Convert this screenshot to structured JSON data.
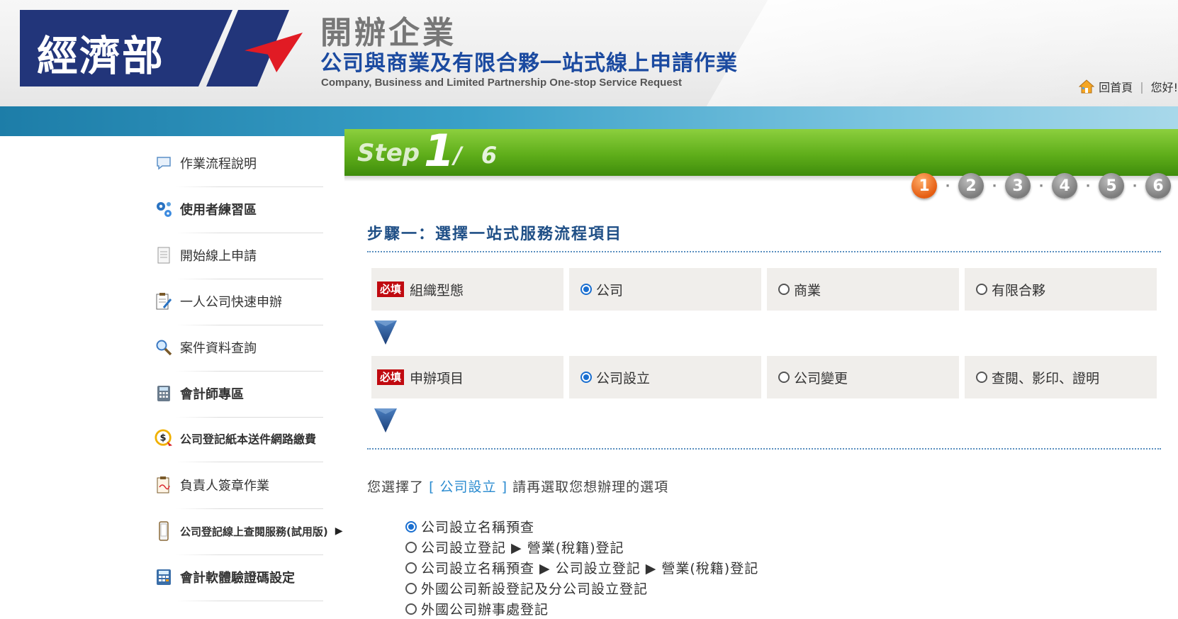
{
  "header": {
    "logo_text": "經濟部",
    "brand_title": "開辦企業",
    "brand_subtitle": "公司與商業及有限合夥一站式線上申請作業",
    "brand_english": "Company, Business and Limited Partnership One-stop Service Request",
    "home_link": "回首頁",
    "greeting": "您好!"
  },
  "sidebar": {
    "items": [
      {
        "label": "作業流程說明",
        "icon": "chat-bubble-icon"
      },
      {
        "label": "使用者練習區",
        "icon": "gears-icon"
      },
      {
        "label": "開始線上申請",
        "icon": "document-icon"
      },
      {
        "label": "一人公司快速申辦",
        "icon": "clipboard-pen-icon"
      },
      {
        "label": "案件資料查詢",
        "icon": "magnifier-icon"
      },
      {
        "label": "會計師專區",
        "icon": "calculator-icon"
      },
      {
        "label": "公司登記紙本送件網路繳費",
        "icon": "dollar-coin-icon"
      },
      {
        "label": "負責人簽章作業",
        "icon": "clipboard-sign-icon"
      },
      {
        "label": "公司登記線上查閱服務(試用版)",
        "icon": "phone-icon"
      },
      {
        "label": "會計軟體驗證碼設定",
        "icon": "calculator-blue-icon"
      }
    ]
  },
  "step": {
    "label": "Step",
    "current": "1",
    "total": "/ 6",
    "dots": [
      "1",
      "2",
      "3",
      "4",
      "5",
      "6"
    ],
    "active": 1
  },
  "main": {
    "section_title": "步驟一：選擇一站式服務流程項目",
    "required_badge": "必填",
    "rows": [
      {
        "label": "組織型態",
        "options": [
          "公司",
          "商業",
          "有限合夥"
        ],
        "selected": 0
      },
      {
        "label": "申辦項目",
        "options": [
          "公司設立",
          "公司變更",
          "查閱、影印、證明"
        ],
        "selected": 0
      }
    ],
    "selected_prefix": "您選擇了",
    "selected_open": "[",
    "selected_value": "公司設立",
    "selected_close": "]",
    "selected_suffix": "請再選取您想辦理的選項",
    "choices": [
      "公司設立名稱預查",
      "公司設立登記 ▶ 營業(稅籍)登記",
      "公司設立名稱預查 ▶ 公司設立登記 ▶ 營業(稅籍)登記",
      "外國公司新設登記及分公司設立登記",
      "外國公司辦事處登記"
    ],
    "choice_selected": 0
  }
}
